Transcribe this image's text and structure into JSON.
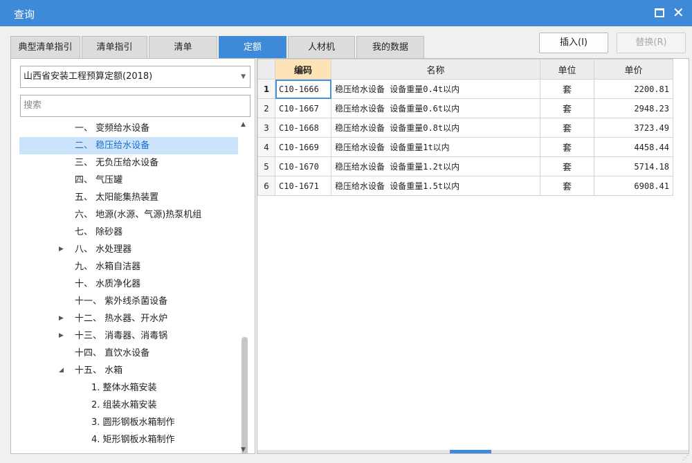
{
  "window": {
    "title": "查询"
  },
  "tabs": [
    {
      "label": "典型清单指引"
    },
    {
      "label": "清单指引"
    },
    {
      "label": "清单"
    },
    {
      "label": "定额",
      "active": true
    },
    {
      "label": "人材机"
    },
    {
      "label": "我的数据"
    }
  ],
  "buttons": {
    "insert": "插入(I)",
    "replace": "替换(R)"
  },
  "left": {
    "select_value": "山西省安装工程预算定额(2018)",
    "search_placeholder": "搜索",
    "tree": [
      {
        "text": "一、 变频给水设备"
      },
      {
        "text": "二、 稳压给水设备",
        "selected": true
      },
      {
        "text": "三、 无负压给水设备"
      },
      {
        "text": "四、 气压罐"
      },
      {
        "text": "五、 太阳能集热装置"
      },
      {
        "text": "六、 地源(水源、气源)热泵机组"
      },
      {
        "text": "七、 除砂器"
      },
      {
        "text": "八、 水处理器",
        "arrow": "collapsed"
      },
      {
        "text": "九、 水箱自洁器"
      },
      {
        "text": "十、 水质净化器"
      },
      {
        "text": "十一、 紫外线杀菌设备"
      },
      {
        "text": "十二、 热水器、开水炉",
        "arrow": "collapsed"
      },
      {
        "text": "十三、 消毒器、消毒锅",
        "arrow": "collapsed"
      },
      {
        "text": "十四、 直饮水设备"
      },
      {
        "text": "十五、 水箱",
        "arrow": "expanded"
      },
      {
        "text": "1. 整体水箱安装",
        "child": true
      },
      {
        "text": "2. 组装水箱安装",
        "child": true
      },
      {
        "text": "3. 圆形钢板水箱制作",
        "child": true
      },
      {
        "text": "4. 矩形钢板水箱制作",
        "child": true
      }
    ]
  },
  "table": {
    "headers": {
      "code": "编码",
      "name": "名称",
      "unit": "单位",
      "price": "单价"
    },
    "rows": [
      {
        "num": "1",
        "code": "C10-1666",
        "name": "稳压给水设备 设备重量0.4t以内",
        "unit": "套",
        "price": "2200.81"
      },
      {
        "num": "2",
        "code": "C10-1667",
        "name": "稳压给水设备 设备重量0.6t以内",
        "unit": "套",
        "price": "2948.23"
      },
      {
        "num": "3",
        "code": "C10-1668",
        "name": "稳压给水设备 设备重量0.8t以内",
        "unit": "套",
        "price": "3723.49"
      },
      {
        "num": "4",
        "code": "C10-1669",
        "name": "稳压给水设备 设备重量1t以内",
        "unit": "套",
        "price": "4458.44"
      },
      {
        "num": "5",
        "code": "C10-1670",
        "name": "稳压给水设备 设备重量1.2t以内",
        "unit": "套",
        "price": "5714.18"
      },
      {
        "num": "6",
        "code": "C10-1671",
        "name": "稳压给水设备 设备重量1.5t以内",
        "unit": "套",
        "price": "6908.41"
      }
    ]
  },
  "icons": {
    "maximize": "maximize-icon",
    "close": "close-icon",
    "dropdown": "chevron-down-icon"
  },
  "colors": {
    "accent": "#3e8ad8",
    "header_highlight": "#fde3b6",
    "selected_row": "#cce4fb"
  }
}
